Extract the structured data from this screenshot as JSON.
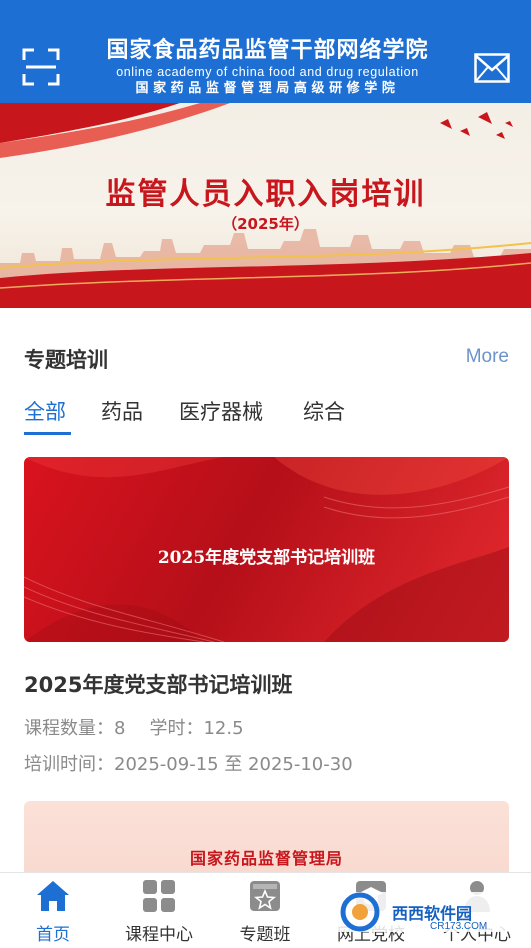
{
  "header": {
    "title": "国家食品药品监管干部网络学院",
    "subtitle_en": "online academy of china food and drug regulation",
    "subtitle_cn": "国家药品监督管理局高级研修学院",
    "left_icon": "scan-icon",
    "right_icon": "mail-icon",
    "color": "#1d6fd3"
  },
  "banner": {
    "title": "监管人员入职入岗培训",
    "year": "（2025年）",
    "color": "#c8161d"
  },
  "section": {
    "title": "专题培训",
    "more": "More",
    "tabs": [
      {
        "label": "全部",
        "active": true
      },
      {
        "label": "药品",
        "active": false
      },
      {
        "label": "医疗器械",
        "active": false
      },
      {
        "label": "综合",
        "active": false
      }
    ]
  },
  "courses": [
    {
      "image_title": "2025年度党支部书记培训班",
      "name": "2025年度党支部书记培训班",
      "count_label": "课程数量：",
      "count": "8",
      "hours_label": "学时：",
      "hours": "12.5",
      "time_label": "培训时间：",
      "time": "2025-09-15 至 2025-10-30"
    },
    {
      "image_title": "国家药品监督管理局"
    }
  ],
  "bottom_nav": [
    {
      "label": "首页",
      "icon": "home-icon",
      "active": true
    },
    {
      "label": "课程中心",
      "icon": "grid-icon",
      "active": false
    },
    {
      "label": "专题班",
      "icon": "book-star-icon",
      "active": false
    },
    {
      "label": "网上党校",
      "icon": "graduation-cap-icon",
      "active": false
    },
    {
      "label": "个人中心",
      "icon": "person-icon",
      "active": false
    }
  ],
  "watermark": {
    "text": "西西软件园",
    "small": "CR173.COM"
  }
}
